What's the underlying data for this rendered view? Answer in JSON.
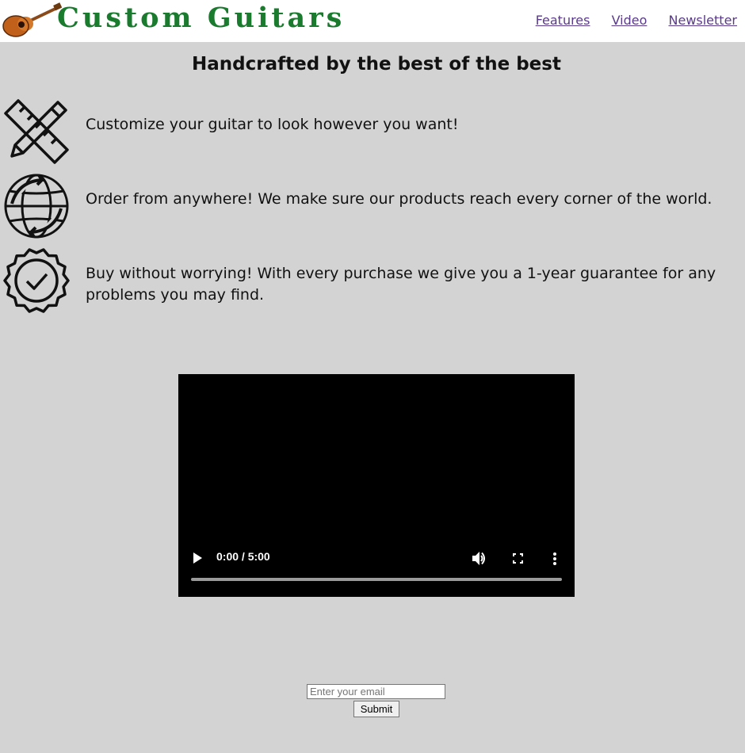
{
  "header": {
    "logo_text": "Custom Guitars",
    "nav": [
      "Features",
      "Video",
      "Newsletter"
    ]
  },
  "hero": {
    "title": "Handcrafted by the best of the best"
  },
  "features": [
    {
      "icon": "pencil-ruler-icon",
      "text": "Customize your guitar to look however you want!"
    },
    {
      "icon": "globe-shipping-icon",
      "text": "Order from anywhere! We make sure our products reach every corner of the world."
    },
    {
      "icon": "guarantee-badge-icon",
      "text": "Buy without worrying! With every purchase we give you a 1-year guarantee for any problems you may find."
    }
  ],
  "video": {
    "time": "0:00 / 5:00",
    "progress": 0
  },
  "newsletter": {
    "placeholder": "Enter your email",
    "submit_label": "Submit"
  },
  "colors": {
    "background": "#d3d3d3",
    "logo": "#1a7a2e",
    "link": "#5a3a8a"
  }
}
